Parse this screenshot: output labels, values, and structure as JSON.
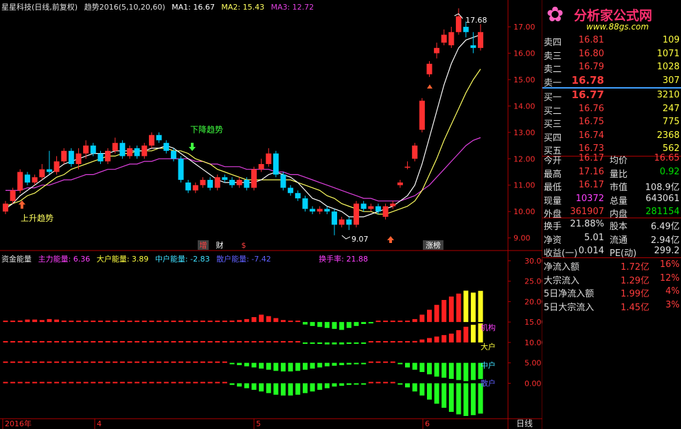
{
  "header": {
    "stock_title": "星星科技(日线,前复权)",
    "indicator": "趋势2016(5,10,20,60)",
    "ma1": "MA1: 16.67",
    "ma2": "MA2: 15.43",
    "ma3": "MA3: 12.72"
  },
  "logo": {
    "text": "分析家公式网",
    "url": "www.88gs.com"
  },
  "annotations": {
    "up_trend": "上升趋势",
    "down_trend": "下降趋势",
    "high_label": "17.68",
    "low_label": "9.07",
    "tag_zeng": "增",
    "tag_cai": "财",
    "tag_$": "$",
    "tag_zhangbang": "涨榜"
  },
  "sub_header": {
    "name": "资金能量",
    "main": "主力能量: 6.36",
    "big": "大户能量: 3.89",
    "mid": "中户能量: -2.83",
    "retail": "散户能量: -7.42",
    "turnover": "换手率: 21.88"
  },
  "sub_legend": {
    "jigou": "机构",
    "dahu": "大户",
    "zhonghu": "中户",
    "sanhu": "散户"
  },
  "x_axis": {
    "labels": [
      "2016年",
      "4",
      "5",
      "6"
    ],
    "period": "日线"
  },
  "order_book": {
    "sell": [
      {
        "label": "卖四",
        "price": "16.81",
        "vol": "109"
      },
      {
        "label": "卖三",
        "price": "16.80",
        "vol": "1071"
      },
      {
        "label": "卖二",
        "price": "16.79",
        "vol": "1028"
      },
      {
        "label": "卖一",
        "price": "16.78",
        "vol": "307"
      }
    ],
    "buy": [
      {
        "label": "买一",
        "price": "16.77",
        "vol": "3210"
      },
      {
        "label": "买二",
        "price": "16.76",
        "vol": "247"
      },
      {
        "label": "买三",
        "price": "16.75",
        "vol": "775"
      },
      {
        "label": "买四",
        "price": "16.74",
        "vol": "2368"
      },
      {
        "label": "买五",
        "price": "16.73",
        "vol": "562"
      }
    ]
  },
  "stats": [
    {
      "l1": "今开",
      "v1": "16.17",
      "l2": "均价",
      "v2": "16.65"
    },
    {
      "l1": "最高",
      "v1": "17.16",
      "l2": "量比",
      "v2": "0.92"
    },
    {
      "l1": "最低",
      "v1": "16.17",
      "l2": "市值",
      "v2": "108.9亿"
    },
    {
      "l1": "现量",
      "v1": "10372",
      "l2": "总量",
      "v2": "643061"
    },
    {
      "l1": "外盘",
      "v1": "361907",
      "l2": "内盘",
      "v2": "281154"
    }
  ],
  "fund": [
    {
      "l1": "换手",
      "v1": "21.88%",
      "l2": "股本",
      "v2": "6.49亿"
    },
    {
      "l1": "净资",
      "v1": "5.01",
      "l2": "流通",
      "v2": "2.94亿"
    },
    {
      "l1": "收益(一)",
      "v1": "0.014",
      "l2": "PE(动)",
      "v2": "299.2"
    }
  ],
  "flow": [
    {
      "label": "净流入额",
      "value": "1.72亿",
      "pct": "16%"
    },
    {
      "label": "大宗流入",
      "value": "1.29亿",
      "pct": "12%"
    },
    {
      "label": "5日净流入额",
      "value": "1.99亿",
      "pct": "4%"
    },
    {
      "label": "5日大宗流入",
      "value": "1.45亿",
      "pct": "3%"
    }
  ],
  "colors": {
    "up": "#ff3030",
    "down": "#00d0ff",
    "ma1": "#ffffff",
    "ma2": "#ffff60",
    "ma3": "#e040e0"
  },
  "chart_data": [
    {
      "type": "candlestick",
      "title": "星星科技(日线,前复权)",
      "ylim": [
        8.6,
        17.6
      ],
      "y_ticks": [
        "9.00",
        "10.00",
        "11.00",
        "12.00",
        "13.00",
        "14.00",
        "15.00",
        "16.00",
        "17.00"
      ],
      "candles": [
        [
          10.0,
          10.3,
          9.9,
          10.4
        ],
        [
          10.4,
          10.8,
          10.3,
          10.9
        ],
        [
          10.8,
          11.5,
          10.7,
          11.6
        ],
        [
          11.4,
          11.1,
          11.0,
          11.5
        ],
        [
          11.1,
          11.3,
          11.0,
          11.4
        ],
        [
          11.3,
          11.6,
          11.2,
          11.8
        ],
        [
          11.6,
          11.5,
          11.4,
          12.3
        ],
        [
          11.5,
          11.9,
          11.4,
          12.1
        ],
        [
          11.9,
          12.3,
          11.8,
          12.4
        ],
        [
          12.3,
          11.8,
          11.7,
          12.4
        ],
        [
          11.8,
          12.2,
          11.6,
          12.4
        ],
        [
          12.2,
          12.5,
          12.0,
          12.7
        ],
        [
          12.5,
          12.2,
          12.1,
          12.6
        ],
        [
          12.2,
          11.9,
          11.8,
          12.3
        ],
        [
          11.9,
          12.3,
          11.8,
          12.4
        ],
        [
          12.3,
          12.6,
          12.2,
          12.8
        ],
        [
          12.6,
          12.1,
          12.0,
          12.7
        ],
        [
          12.1,
          12.4,
          12.0,
          12.5
        ],
        [
          12.4,
          12.1,
          12.0,
          12.5
        ],
        [
          12.1,
          12.5,
          12.0,
          12.6
        ],
        [
          12.5,
          12.9,
          12.4,
          13.0
        ],
        [
          12.9,
          12.7,
          12.6,
          13.0
        ],
        [
          12.6,
          12.3,
          12.2,
          12.7
        ],
        [
          12.3,
          12.0,
          11.9,
          12.4
        ],
        [
          12.0,
          11.2,
          11.1,
          12.1
        ],
        [
          11.1,
          10.8,
          10.7,
          11.2
        ],
        [
          10.8,
          11.0,
          10.7,
          11.1
        ],
        [
          11.0,
          11.2,
          10.9,
          11.3
        ],
        [
          11.2,
          10.9,
          10.8,
          11.3
        ],
        [
          10.9,
          11.3,
          10.8,
          11.4
        ],
        [
          11.3,
          11.2,
          11.1,
          11.4
        ],
        [
          11.2,
          11.0,
          10.9,
          11.3
        ],
        [
          11.0,
          11.2,
          10.9,
          11.3
        ],
        [
          11.2,
          10.9,
          10.8,
          11.3
        ],
        [
          10.9,
          11.6,
          10.8,
          11.7
        ],
        [
          11.6,
          11.8,
          11.5,
          12.0
        ],
        [
          11.8,
          12.2,
          11.7,
          12.4
        ],
        [
          12.2,
          11.4,
          11.3,
          12.3
        ],
        [
          11.4,
          10.9,
          10.8,
          11.5
        ],
        [
          10.9,
          10.7,
          10.6,
          11.0
        ],
        [
          10.7,
          10.5,
          10.4,
          10.8
        ],
        [
          10.5,
          10.1,
          10.0,
          10.6
        ],
        [
          10.1,
          10.0,
          9.9,
          10.2
        ],
        [
          10.0,
          10.1,
          9.9,
          10.2
        ],
        [
          10.1,
          10.0,
          9.9,
          10.2
        ],
        [
          10.0,
          9.5,
          9.1,
          10.1
        ],
        [
          9.5,
          9.7,
          9.4,
          9.8
        ],
        [
          9.7,
          9.5,
          9.3,
          9.8
        ],
        [
          9.5,
          10.3,
          9.4,
          10.4
        ],
        [
          10.3,
          10.1,
          10.0,
          10.4
        ],
        [
          10.1,
          10.2,
          10.0,
          10.3
        ],
        [
          10.2,
          10.0,
          9.9,
          10.3
        ],
        [
          9.8,
          10.2,
          9.7,
          10.3
        ],
        [
          10.2,
          10.3,
          10.1,
          10.4
        ],
        [
          11.0,
          11.1,
          10.9,
          11.2
        ],
        [
          11.7,
          11.7,
          11.6,
          11.9
        ],
        [
          12.0,
          12.5,
          11.9,
          12.6
        ],
        [
          13.1,
          14.2,
          13.0,
          14.3
        ],
        [
          15.2,
          15.6,
          15.1,
          15.7
        ],
        [
          16.0,
          16.2,
          15.8,
          16.4
        ],
        [
          16.4,
          16.7,
          16.3,
          16.9
        ],
        [
          16.3,
          16.8,
          16.2,
          17.0
        ],
        [
          16.8,
          17.4,
          16.7,
          17.7
        ],
        [
          17.0,
          16.8,
          16.6,
          17.2
        ],
        [
          16.3,
          16.2,
          16.0,
          16.8
        ],
        [
          16.2,
          16.8,
          16.1,
          17.1
        ]
      ],
      "ma1": [
        10.1,
        10.3,
        10.6,
        10.8,
        11.0,
        11.2,
        11.4,
        11.6,
        11.8,
        11.9,
        12.0,
        12.1,
        12.2,
        12.2,
        12.2,
        12.3,
        12.3,
        12.3,
        12.3,
        12.3,
        12.4,
        12.4,
        12.5,
        12.4,
        12.2,
        12.0,
        11.8,
        11.6,
        11.4,
        11.2,
        11.1,
        11.1,
        11.1,
        11.1,
        11.1,
        11.2,
        11.4,
        11.5,
        11.4,
        11.3,
        11.1,
        10.8,
        10.5,
        10.4,
        10.2,
        10.1,
        10.0,
        9.8,
        9.8,
        9.8,
        9.9,
        10.0,
        10.1,
        10.2,
        10.4,
        10.6,
        11.0,
        11.8,
        12.8,
        13.8,
        14.8,
        15.6,
        16.2,
        16.5,
        16.6,
        16.7
      ],
      "ma2": [
        10.2,
        10.3,
        10.4,
        10.6,
        10.7,
        10.9,
        11.1,
        11.3,
        11.4,
        11.6,
        11.7,
        11.8,
        11.9,
        12.0,
        12.1,
        12.1,
        12.2,
        12.2,
        12.3,
        12.3,
        12.3,
        12.4,
        12.4,
        12.3,
        12.3,
        12.2,
        12.0,
        11.9,
        11.8,
        11.6,
        11.5,
        11.4,
        11.3,
        11.2,
        11.2,
        11.2,
        11.2,
        11.2,
        11.2,
        11.2,
        11.1,
        11.0,
        10.9,
        10.8,
        10.6,
        10.5,
        10.3,
        10.2,
        10.1,
        10.0,
        10.0,
        9.9,
        9.9,
        10.0,
        10.1,
        10.2,
        10.4,
        10.8,
        11.4,
        12.0,
        12.7,
        13.3,
        13.9,
        14.5,
        15.0,
        15.4
      ],
      "ma3": [
        10.8,
        10.8,
        10.8,
        10.9,
        10.9,
        11.0,
        11.0,
        11.1,
        11.2,
        11.2,
        11.3,
        11.4,
        11.4,
        11.5,
        11.6,
        11.6,
        11.7,
        11.8,
        11.8,
        11.9,
        11.9,
        12.0,
        12.0,
        12.0,
        12.0,
        12.0,
        11.9,
        11.9,
        11.8,
        11.8,
        11.7,
        11.7,
        11.7,
        11.6,
        11.6,
        11.6,
        11.6,
        11.5,
        11.5,
        11.4,
        11.4,
        11.3,
        11.2,
        11.1,
        11.0,
        10.9,
        10.8,
        10.7,
        10.6,
        10.5,
        10.5,
        10.4,
        10.4,
        10.4,
        10.4,
        10.5,
        10.6,
        10.8,
        11.0,
        11.3,
        11.6,
        11.9,
        12.2,
        12.5,
        12.7,
        12.8
      ]
    },
    {
      "type": "bar",
      "title": "资金能量",
      "ylim": [
        -8,
        32
      ],
      "y_ticks": [
        "0.00",
        "5.00",
        "10.00",
        "15.00",
        "20.00",
        "25.00",
        "30.00"
      ],
      "series": [
        {
          "name": "主力能量",
          "values": [
            0.2,
            0.2,
            0.3,
            0.5,
            0.5,
            0.4,
            0.6,
            0.5,
            0.3,
            0.2,
            0.2,
            0.2,
            0.1,
            0.1,
            0.1,
            0.1,
            0.1,
            0.1,
            0.1,
            0.1,
            0.1,
            0.1,
            0.1,
            0.1,
            0.1,
            0.1,
            0.1,
            0.1,
            0.1,
            0.2,
            0.2,
            0.3,
            0.4,
            0.6,
            1.0,
            1.5,
            1.2,
            0.8,
            0.4,
            0.2,
            0.1,
            -0.5,
            -0.8,
            -1.0,
            -1.2,
            -1.4,
            -1.6,
            -1.2,
            -0.8,
            -0.4,
            -0.2,
            0.2,
            0.1,
            0.1,
            0.1,
            0.2,
            0.6,
            1.5,
            2.5,
            3.5,
            4.5,
            5.2,
            5.8,
            6.4,
            6.0,
            6.36
          ]
        },
        {
          "name": "大户能量",
          "values": [
            0.1,
            0.1,
            0.1,
            0.1,
            0.1,
            0.1,
            0.1,
            0.1,
            0.1,
            0.1,
            0.1,
            0.1,
            0.1,
            0.1,
            0.1,
            0.1,
            0.1,
            0.1,
            0.1,
            0.1,
            0.1,
            0.1,
            0.1,
            0.1,
            0.1,
            0.1,
            0.1,
            0.1,
            0.1,
            0.1,
            0.1,
            0.1,
            0.1,
            0.1,
            0.1,
            0.1,
            0.1,
            0.1,
            0.1,
            0.1,
            0.1,
            -0.1,
            -0.2,
            -0.3,
            -0.4,
            -0.4,
            -0.4,
            -0.3,
            -0.2,
            -0.1,
            0.1,
            0.1,
            0.1,
            0.1,
            0.1,
            0.1,
            0.3,
            0.6,
            0.9,
            1.2,
            1.5,
            1.8,
            2.5,
            3.2,
            3.6,
            3.89
          ]
        },
        {
          "name": "中户能量",
          "values": [
            0.1,
            0.1,
            0.1,
            0.1,
            0.1,
            0.1,
            0.1,
            0.1,
            0.1,
            0.1,
            0.1,
            0.1,
            0.1,
            0.1,
            0.1,
            0.1,
            0.1,
            0.1,
            0.1,
            0.1,
            0.1,
            0.1,
            0.1,
            0.1,
            0.1,
            0.1,
            0.1,
            0.1,
            0.1,
            0.1,
            0.1,
            -0.2,
            -0.4,
            -0.6,
            -0.8,
            -1.0,
            -1.2,
            -1.4,
            -1.5,
            -1.5,
            -1.4,
            -1.2,
            -1.0,
            -0.8,
            -0.6,
            -0.5,
            -0.4,
            -0.3,
            -0.2,
            -0.1,
            0.1,
            0.1,
            0.1,
            0.1,
            -0.2,
            -0.8,
            -1.2,
            -1.6,
            -2.0,
            -2.4,
            -2.6,
            -2.8,
            -3.0,
            -3.2,
            -3.0,
            -2.83
          ]
        },
        {
          "name": "散户能量",
          "values": [
            0.1,
            0.1,
            0.1,
            0.1,
            0.1,
            0.1,
            0.1,
            0.1,
            0.1,
            0.1,
            0.1,
            0.1,
            0.1,
            0.1,
            0.1,
            0.1,
            0.1,
            0.1,
            0.1,
            0.1,
            0.1,
            0.1,
            0.1,
            0.1,
            0.1,
            0.1,
            0.1,
            0.1,
            0.1,
            0.1,
            0.1,
            -0.4,
            -0.8,
            -1.2,
            -1.6,
            -2.0,
            -2.4,
            -2.8,
            -3.0,
            -3.0,
            -2.8,
            -2.4,
            -2.0,
            -1.6,
            -1.2,
            -0.8,
            -0.6,
            -0.4,
            -0.2,
            -0.1,
            0.1,
            0.1,
            0.1,
            0.1,
            -0.3,
            -1.0,
            -2.0,
            -3.0,
            -4.0,
            -5.0,
            -6.0,
            -7.0,
            -7.6,
            -8.0,
            -7.8,
            -7.42
          ]
        }
      ]
    }
  ]
}
